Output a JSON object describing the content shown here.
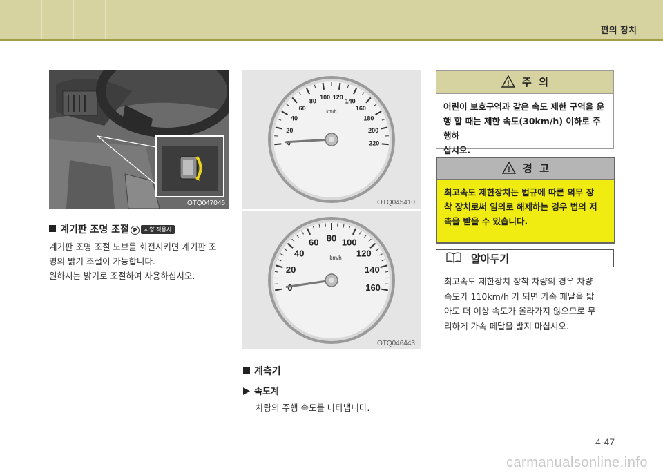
{
  "header": {
    "title": "편의 장치"
  },
  "photo_dash": {
    "label": "OTQ047046"
  },
  "gauge_top": {
    "label": "OTQ045410",
    "unit": "km/h",
    "ticks": [
      "0",
      "20",
      "40",
      "60",
      "80",
      "100",
      "120",
      "140",
      "160",
      "180",
      "200",
      "220"
    ]
  },
  "gauge_bottom": {
    "label": "OTQ046443",
    "unit": "km/h",
    "ticks": [
      "0",
      "20",
      "40",
      "60",
      "80",
      "100",
      "120",
      "140",
      "160"
    ]
  },
  "section1": {
    "title": "계기판 조명 조절",
    "note_mark": "P",
    "badge": "사양 적용시",
    "lines": [
      "계기판 조명 조절 노브를 회전시키면 계기판 조",
      "명의 밝기 조절이 가능합니다.",
      "원하시는 밝기로 조절하여 사용하십시오."
    ]
  },
  "section2": {
    "title": "계측기",
    "sub_title": "속도계",
    "sub_text": "차량의 주행 속도를 나타냅니다."
  },
  "caution": {
    "title": "주  의",
    "lines": [
      "어린이 보호구역과 같은 속도 제한 구역을 운",
      "행 할 때는 제한 속도(30km/h) 이하로 주행하",
      "십시오."
    ]
  },
  "warning": {
    "title": "경  고",
    "lines": [
      "최고속도 제한장치는 법규에 따른 의무 장",
      "착 장치로써 임의로 해제하는 경우 법의 저",
      "촉을 받을 수 있습니다."
    ]
  },
  "tip": {
    "title": "알아두기",
    "lines": [
      "최고속도 제한장치 장착 차량의 경우 차량",
      "속도가 110km/h 가 되면 가속 페달을 밟",
      "아도 더 이상 속도가 올라가지 않으므로 무",
      "리하게 가속 페달을 밟지 마십시오."
    ]
  },
  "footer": {
    "page": "4-47",
    "watermark": "carmanualsonline.info"
  },
  "colors": {
    "header": "#d6d3a0",
    "header_rule": "#a39e45",
    "warning_fill": "#f0ec12",
    "gauge_panel": "#e5e5e5"
  }
}
